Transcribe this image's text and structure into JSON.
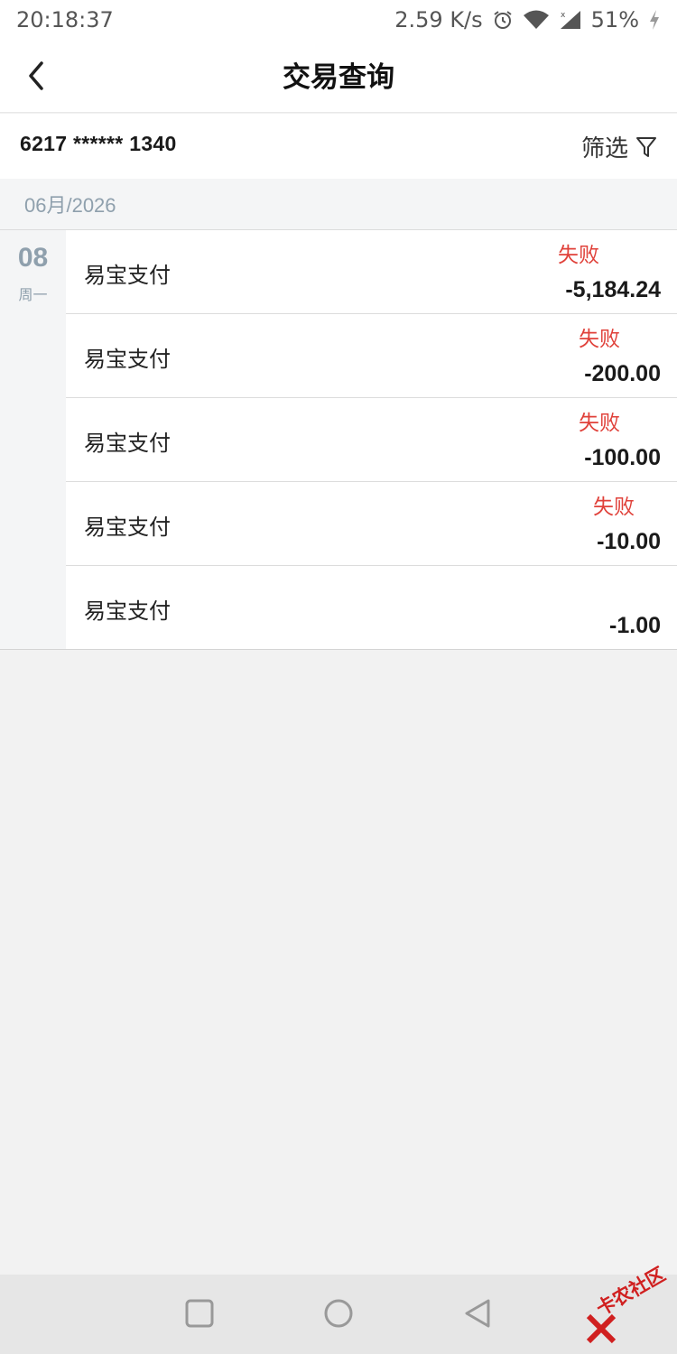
{
  "status_bar": {
    "time": "20:18:37",
    "net_speed": "2.59 K/s",
    "battery": "51%",
    "icons": [
      "alarm-icon",
      "wifi-icon",
      "signal-icon",
      "charging-icon"
    ]
  },
  "nav": {
    "title": "交易查询",
    "back_icon": "chevron-left-icon"
  },
  "account": {
    "number": "6217 ****** 1340",
    "filter_label": "筛选",
    "filter_icon": "funnel-icon"
  },
  "month": {
    "label": "06月/2026"
  },
  "day": {
    "date": "08",
    "weekday": "周一"
  },
  "transactions": [
    {
      "name": "易宝支付",
      "status": "失败",
      "amount": "-5,184.24"
    },
    {
      "name": "易宝支付",
      "status": "失败",
      "amount": "-200.00"
    },
    {
      "name": "易宝支付",
      "status": "失败",
      "amount": "-100.00"
    },
    {
      "name": "易宝支付",
      "status": "失败",
      "amount": "-10.00"
    },
    {
      "name": "易宝支付",
      "status": "",
      "amount": "-1.00"
    }
  ],
  "system_nav": {
    "icons": [
      "recent-apps-icon",
      "home-icon",
      "back-icon"
    ]
  },
  "watermark": {
    "text": "卡农社区"
  },
  "colors": {
    "status_failed": "#e0413a",
    "muted_text": "#8fa0ad",
    "background": "#f2f2f2"
  }
}
